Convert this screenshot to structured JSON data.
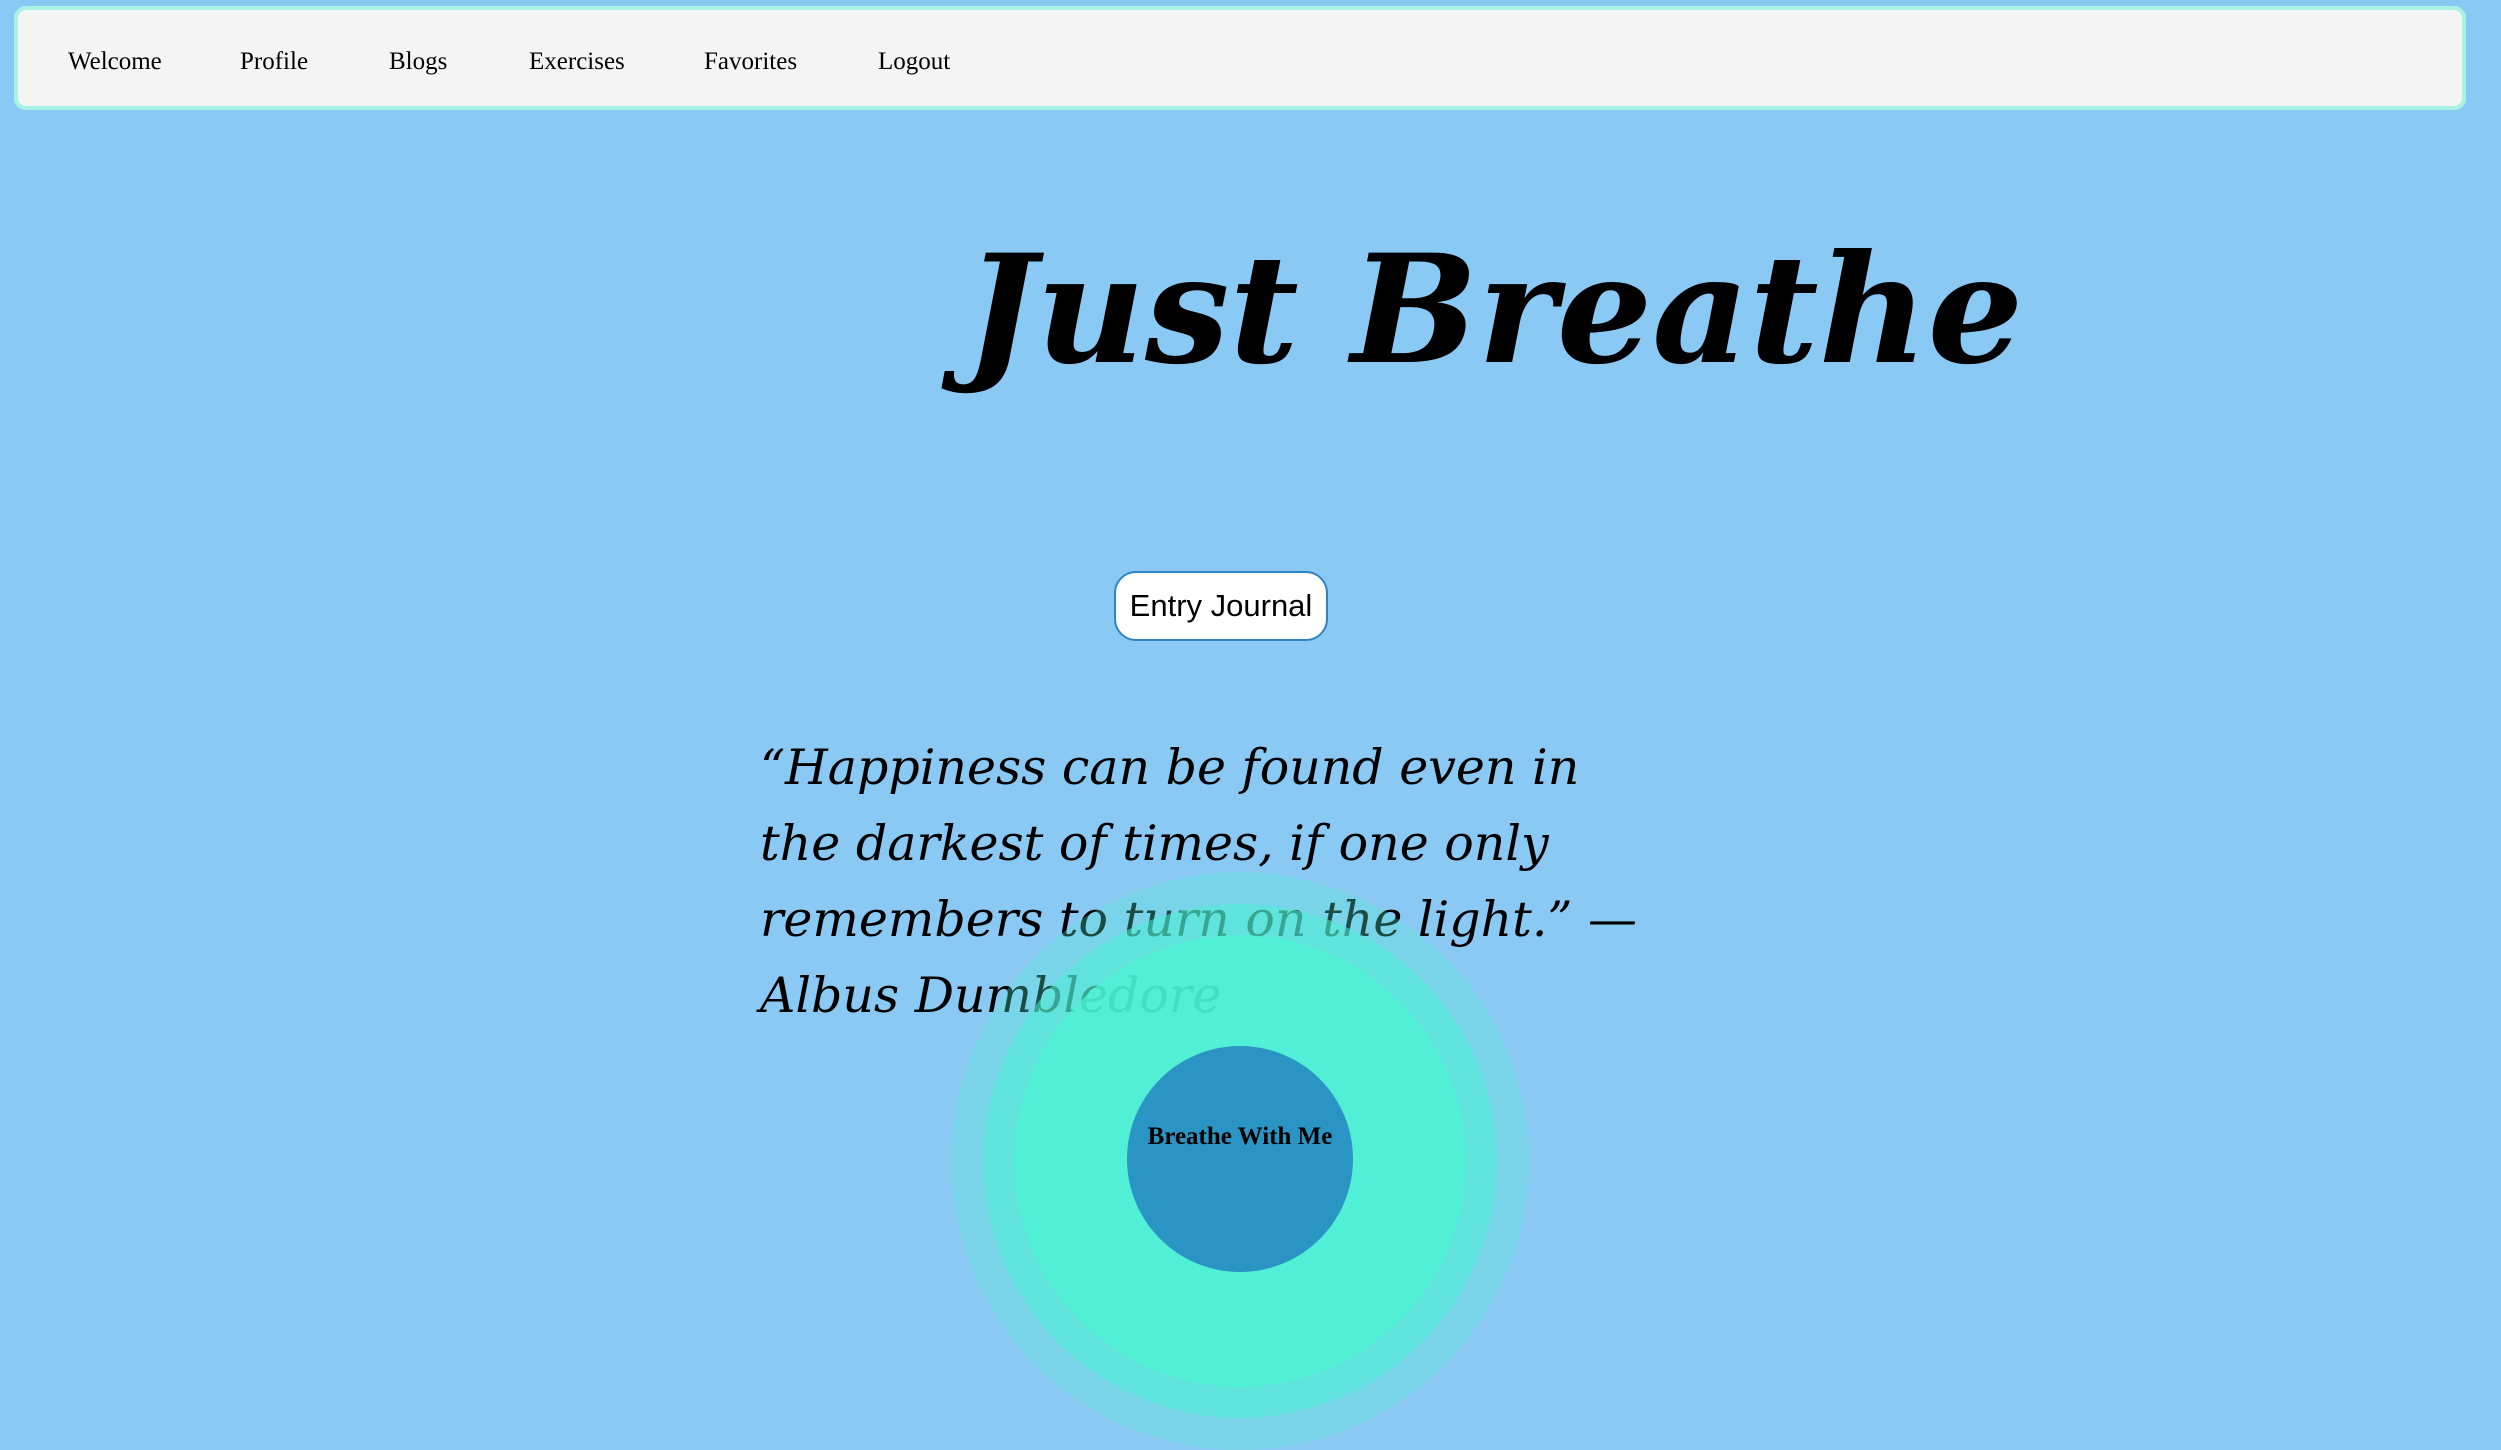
{
  "nav": {
    "items": [
      {
        "label": "Welcome"
      },
      {
        "label": "Profile"
      },
      {
        "label": "Blogs"
      },
      {
        "label": "Exercises"
      },
      {
        "label": "Favorites"
      },
      {
        "label": "Logout"
      }
    ]
  },
  "hero": {
    "title": "Just Breathe"
  },
  "journal_button": {
    "label": "Entry Journal"
  },
  "quote": {
    "text": "“Happiness can be found even in the darkest of times, if one only remembers to turn on the light.” — Albus Dumbledore"
  },
  "breathe": {
    "button_label": "Breathe With Me"
  },
  "colors": {
    "background": "#8bc9f5",
    "navbar": "#f4f4f4",
    "navbar_border": "#a7f3e4",
    "breathe_button": "#2a94c4",
    "glow": "#4ef4d2",
    "journal_border": "#2f82c4"
  }
}
